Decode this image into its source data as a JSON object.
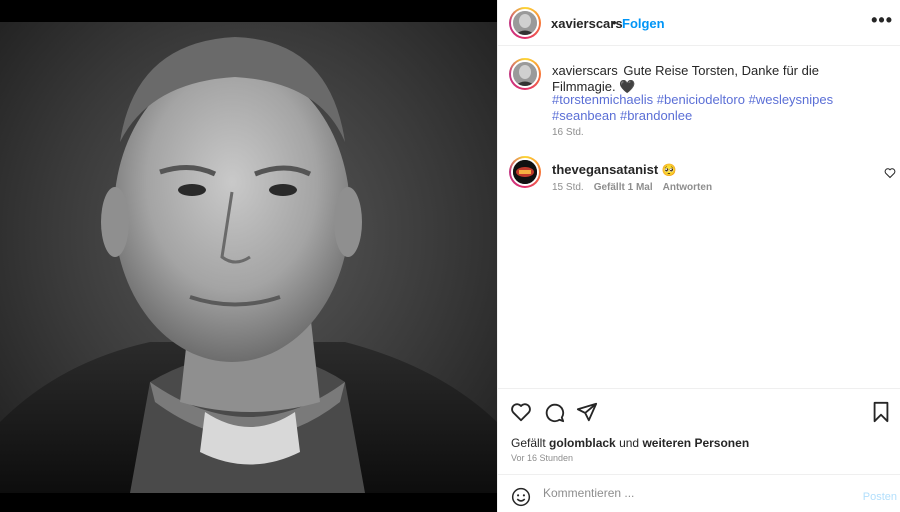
{
  "post": {
    "author": "xavierscars",
    "follow_separator": "•",
    "follow_label": "Folgen",
    "more_label": "•••"
  },
  "caption": {
    "username": "xavierscars",
    "text": "Gute Reise Torsten, Danke für die Filmmagie.",
    "emoji": "🖤",
    "hashtags": [
      "#torstenmichaelis",
      "#beniciodeltoro",
      "#wesleysnipes",
      "#seanbean",
      "#brandonlee"
    ],
    "time": "16 Std."
  },
  "comment": {
    "username": "thevegansatanist",
    "emoji": "🥺",
    "time": "15 Std.",
    "likes_label": "Gefällt 1 Mal",
    "reply_label": "Antworten"
  },
  "likes": {
    "prefix": "Gefällt",
    "user": "golomblack",
    "connector": "und",
    "others": "weiteren Personen"
  },
  "post_time": "Vor 16 Stunden",
  "comment_box": {
    "placeholder": "Kommentieren ...",
    "post_label": "Posten"
  },
  "colors": {
    "accent": "#0095f6",
    "hashtag": "#5b6fd6",
    "muted": "#8e8e8e"
  },
  "icons": [
    "more-options-icon",
    "heart-icon",
    "comment-icon",
    "share-icon",
    "bookmark-icon",
    "emoji-icon"
  ]
}
